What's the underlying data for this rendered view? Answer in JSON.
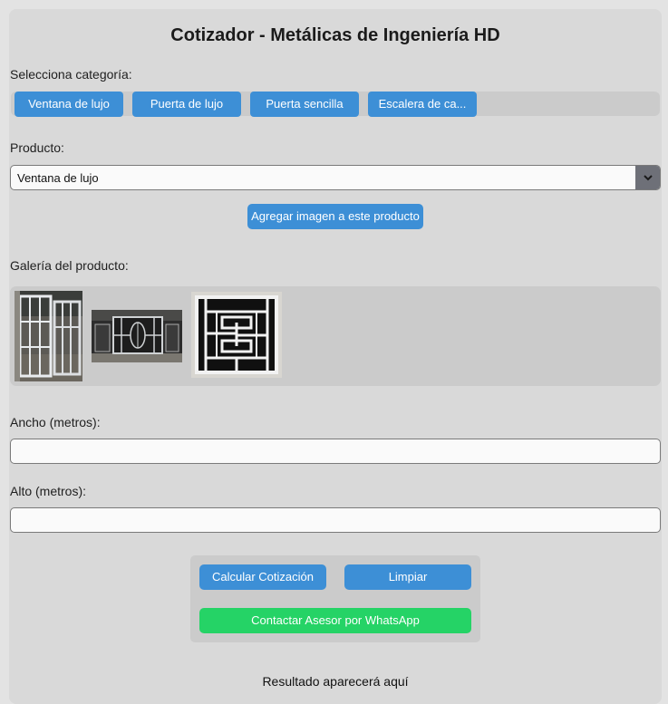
{
  "header": {
    "title": "Cotizador - Metálicas de Ingeniería HD"
  },
  "categories": {
    "label": "Selecciona categoría:",
    "items": [
      "Ventana de lujo",
      "Puerta de lujo",
      "Puerta sencilla",
      "Escalera de ca..."
    ],
    "button_color": "#3d8fd6"
  },
  "product": {
    "label": "Producto:",
    "selected": "Ventana de lujo",
    "add_image_label": "Agregar imagen a este producto"
  },
  "gallery": {
    "label": "Galería del producto:",
    "images": [
      "window-grille-photo",
      "decorative-gate-photo",
      "geometric-window-grille-photo"
    ]
  },
  "width": {
    "label": "Ancho (metros):",
    "value": ""
  },
  "height": {
    "label": "Alto (metros):",
    "value": ""
  },
  "actions": {
    "calculate_label": "Calcular Cotización",
    "clear_label": "Limpiar",
    "whatsapp_label": "Contactar Asesor por WhatsApp",
    "whatsapp_color": "#25d366"
  },
  "result": {
    "text": "Resultado aparecerá aquí"
  }
}
